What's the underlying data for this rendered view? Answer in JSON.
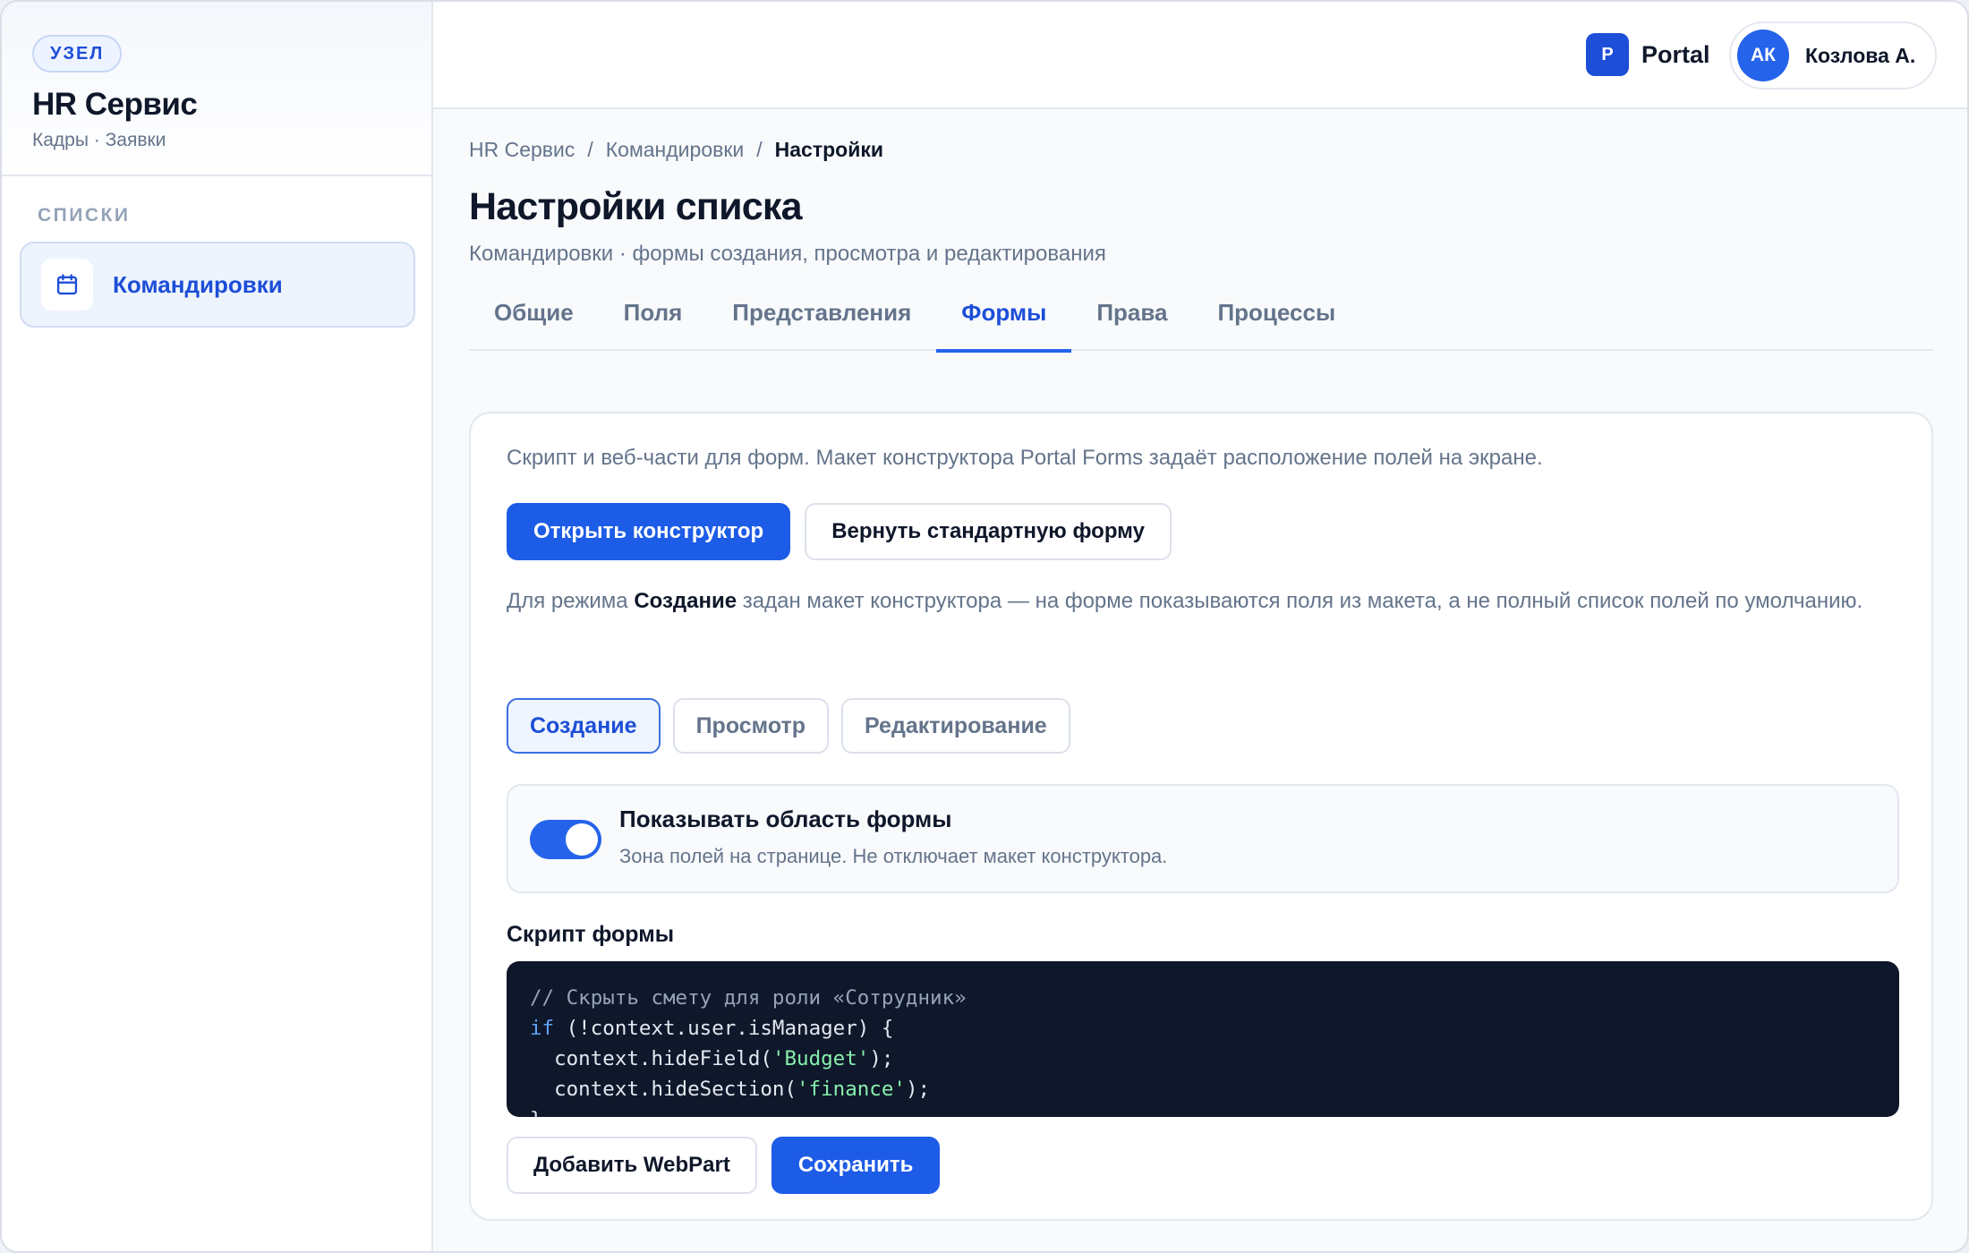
{
  "sidebar": {
    "badge": "УЗЕЛ",
    "title": "HR Сервис",
    "subtitle": "Кадры · Заявки",
    "section_label": "СПИСКИ",
    "items": [
      {
        "label": "Командировки",
        "icon": "calendar-icon",
        "active": true
      }
    ]
  },
  "topbar": {
    "portal_badge": "P",
    "portal_name": "Portal",
    "user_initials": "АК",
    "user_name": "Козлова А."
  },
  "breadcrumb": [
    "HR Сервис",
    "Командировки",
    "Настройки"
  ],
  "page": {
    "title": "Настройки списка",
    "subtitle": "Командировки · формы создания, просмотра и редактирования"
  },
  "tabs": [
    "Общие",
    "Поля",
    "Представления",
    "Формы",
    "Права",
    "Процессы"
  ],
  "active_tab": "Формы",
  "forms": {
    "description": "Скрипт и веб-части для форм. Макет конструктора Portal Forms задаёт расположение полей на экране.",
    "open_designer_label": "Открыть конструктор",
    "reset_form_label": "Вернуть стандартную форму",
    "mode_note_prefix": "Для режима",
    "mode_note_mode": "Создание",
    "mode_note_suffix": "задан макет конструктора — на форме показываются поля из макета, а не полный список полей по умолчанию.",
    "modes": [
      "Создание",
      "Просмотр",
      "Редактирование"
    ],
    "active_mode": "Создание",
    "toggle": {
      "title": "Показывать область формы",
      "description": "Зона полей на странице. Не отключает макет конструктора.",
      "on": true
    },
    "script_label": "Скрипт формы",
    "code": {
      "comment": "// Скрыть смету для роли «Сотрудник»",
      "line2_kw": "if",
      "line2_rest": " (!context.user.isManager) {",
      "line3_pre": "  context.hideField(",
      "line3_str": "'Budget'",
      "line3_post": ");",
      "line4_pre": "  context.hideSection(",
      "line4_str": "'finance'",
      "line4_post": ");",
      "line5": "}"
    },
    "add_webpart_label": "Добавить WebPart",
    "save_label": "Сохранить"
  },
  "colors": {
    "accent": "#1d5ce6",
    "accent_text": "#1d4ed8",
    "code_bg": "#0f172a",
    "muted": "#64748b"
  }
}
